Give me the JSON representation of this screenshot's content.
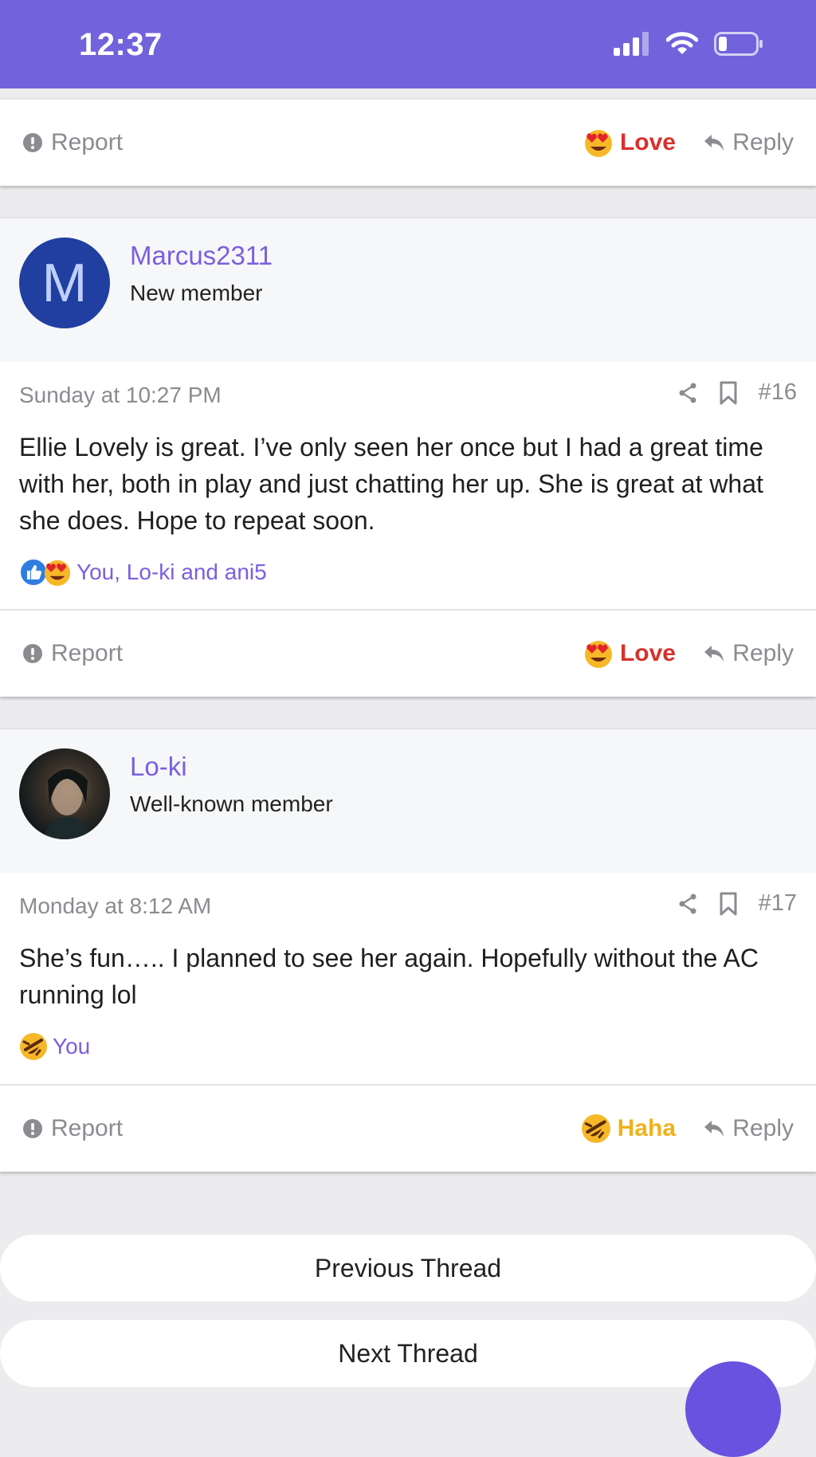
{
  "status_bar": {
    "time": "12:37"
  },
  "top_action_bar": {
    "report": "Report",
    "reaction": "Love",
    "reply": "Reply"
  },
  "posts": [
    {
      "author": "Marcus2311",
      "role": "New member",
      "avatar_letter": "M",
      "date": "Sunday at 10:27 PM",
      "number": "#16",
      "body": "Ellie Lovely is great. I’ve only seen her once but I had a great time with her, both in play and just chatting her up. She is great at what she does. Hope to repeat soon.",
      "reactions_text": "You, Lo-ki and ani5",
      "actions": {
        "report": "Report",
        "reaction": "Love",
        "reply": "Reply"
      }
    },
    {
      "author": "Lo-ki",
      "role": "Well-known member",
      "date": "Monday at 8:12 AM",
      "number": "#17",
      "body": "She’s fun….. I planned to see her again. Hopefully without the AC running lol",
      "reactions_text": "You",
      "actions": {
        "report": "Report",
        "reaction": "Haha",
        "reply": "Reply"
      }
    }
  ],
  "navigation": {
    "previous": "Previous Thread",
    "next": "Next Thread"
  },
  "colors": {
    "header": "#7262dc",
    "username": "#7b5ee0",
    "love": "#d9302c",
    "haha": "#f0b21a",
    "avatar_bg": "#203fa1"
  }
}
